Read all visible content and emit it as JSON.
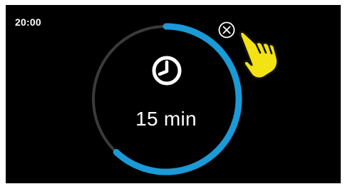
{
  "status_bar": {
    "time": "20:00"
  },
  "timer": {
    "value_label": "15 min",
    "progress": 0.62,
    "progress_color": "#1a9ad6",
    "track_color": "#3a3a3a",
    "icon": "clock-icon"
  },
  "controls": {
    "close_icon": "close-circle-icon"
  },
  "overlay": {
    "pointer_icon": "pointing-hand-icon",
    "pointer_color": "#f3e214"
  }
}
